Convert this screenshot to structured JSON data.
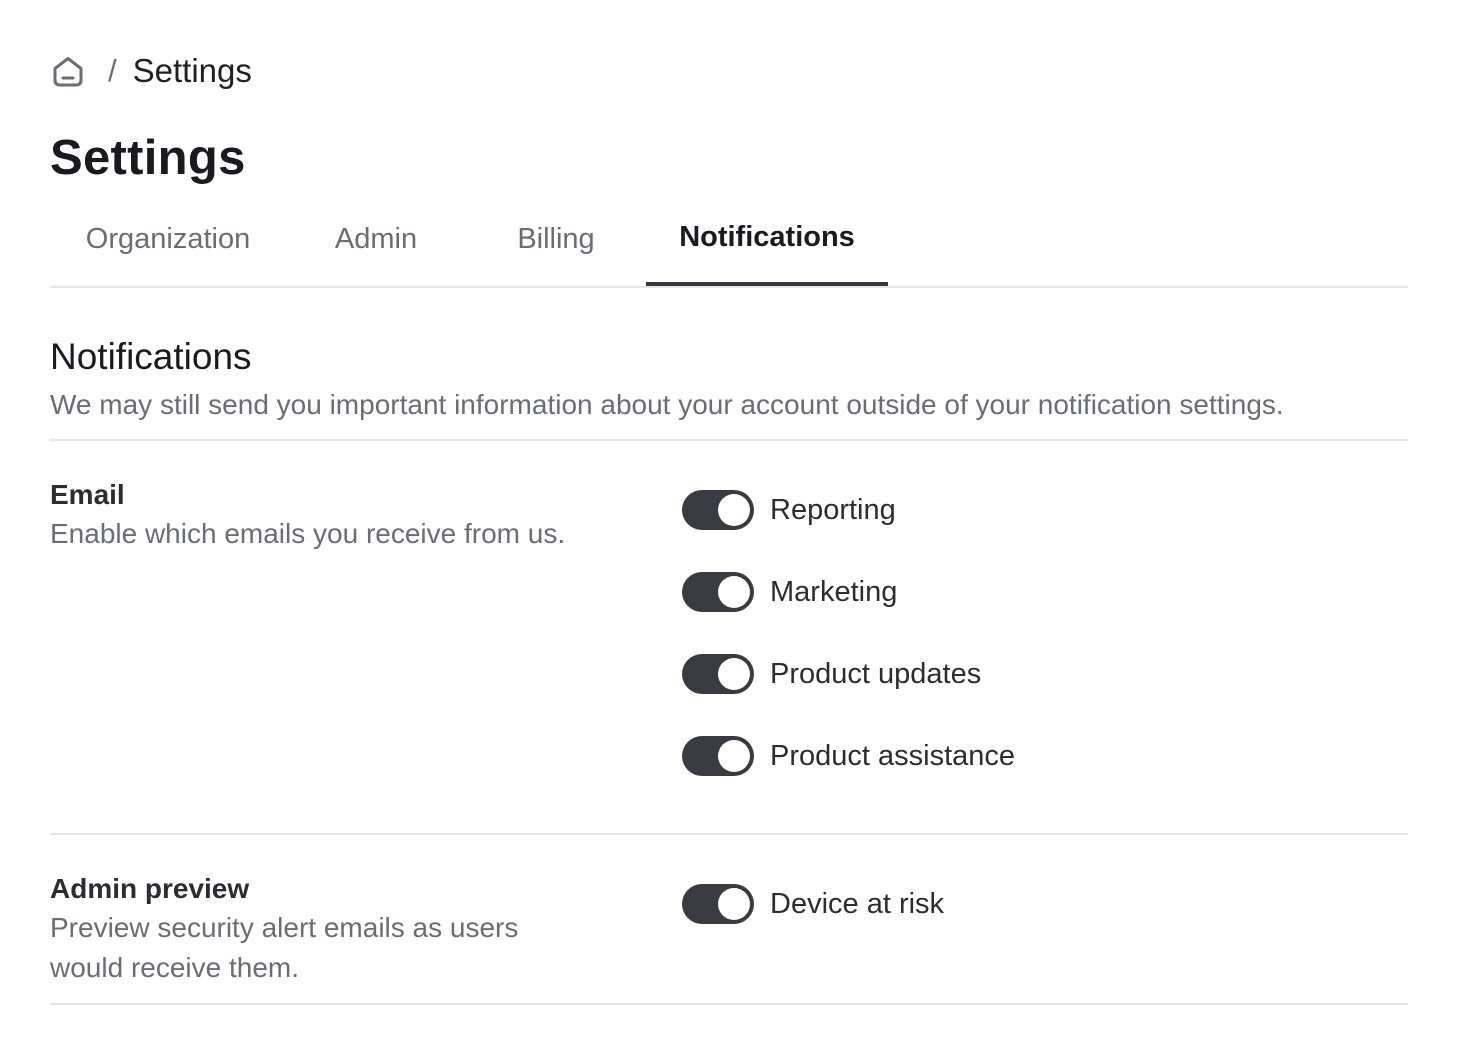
{
  "breadcrumb": {
    "home_icon": "home-icon",
    "separator": "/",
    "current": "Settings"
  },
  "page_title": "Settings",
  "tabs": [
    {
      "label": "Organization",
      "active": false
    },
    {
      "label": "Admin",
      "active": false
    },
    {
      "label": "Billing",
      "active": false
    },
    {
      "label": "Notifications",
      "active": true
    }
  ],
  "section": {
    "title": "Notifications",
    "description": "We may still send you important information about your account outside of your notification settings."
  },
  "email_group": {
    "title": "Email",
    "description": "Enable which emails you receive from us.",
    "toggles": [
      {
        "label": "Reporting",
        "on": true
      },
      {
        "label": "Marketing",
        "on": true
      },
      {
        "label": "Product updates",
        "on": true
      },
      {
        "label": "Product assistance",
        "on": true
      }
    ]
  },
  "admin_group": {
    "title": "Admin preview",
    "description_line1": "Preview security alert emails as users",
    "description_line2": "would receive them.",
    "toggles": [
      {
        "label": "Device at risk",
        "on": true
      }
    ]
  },
  "colors": {
    "toggle_on": "#393b40",
    "active_tab_indicator": "#34363c",
    "muted_text": "#6a6d75",
    "divider": "#e3e4e7"
  }
}
